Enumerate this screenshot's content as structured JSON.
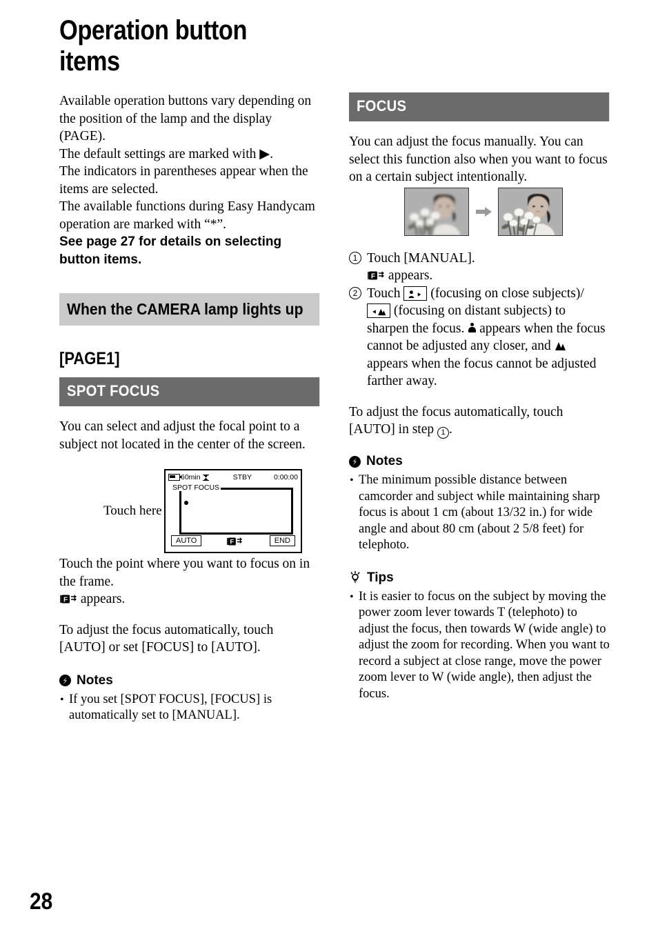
{
  "page": {
    "title": "Operation button\nitems",
    "number": "28"
  },
  "left_column": {
    "intro": "Available operation buttons vary depending on the position of the lamp and the display (PAGE).\nThe default settings are marked with ▶.\nThe indicators in parentheses appear when the items are selected.\nThe available functions during Easy Handycam operation are marked with “*”.",
    "intro_bold": "See page 27 for details on selecting button items.",
    "section_heading": "When the CAMERA lamp lights up",
    "page_label": "[PAGE1]",
    "subsection_heading": "SPOT FOCUS",
    "body1": "You can select and adjust the focal point to a subject not located in the center of the screen.",
    "diagram": {
      "callout": "Touch here",
      "battery_time": "60min",
      "status": "STBY",
      "timecode": "0:00:00",
      "mode_label": "SPOT FOCUS",
      "button_auto": "AUTO",
      "button_end": "END",
      "center_icon": "manual-focus-icon"
    },
    "body2_line1": "Touch the point where you want to focus on in the frame.",
    "body2_line2_suffix": "appears.",
    "body3": "To adjust the focus automatically, touch [AUTO] or set [FOCUS] to [AUTO].",
    "notes": {
      "title": "Notes",
      "items": [
        "If you set [SPOT FOCUS], [FOCUS] is automatically set to [MANUAL]."
      ]
    }
  },
  "right_column": {
    "subsection_heading": "FOCUS",
    "body1": "You can adjust the focus manually. You can select this function also when you want to focus on a certain subject intentionally.",
    "photos": {
      "left_caption": "out-of-focus-photo",
      "right_caption": "in-focus-photo",
      "arrow": "arrow-right-icon"
    },
    "steps": [
      {
        "num": "1",
        "text": "Touch [MANUAL].",
        "sub_suffix": "appears."
      },
      {
        "num": "2",
        "text_a": "Touch",
        "text_b": "(focusing on close subjects)/",
        "text_c": "(focusing on distant subjects) to sharpen the focus.",
        "text_d": "appears when the focus cannot be adjusted any closer, and",
        "text_e": "appears when the focus cannot be adjusted farther away."
      }
    ],
    "auto_note_a": "To adjust the focus automatically, touch [AUTO] in step",
    "auto_note_b": ".",
    "notes": {
      "title": "Notes",
      "items": [
        "The minimum possible distance between camcorder and subject while maintaining sharp focus is about 1 cm (about 13/32 in.) for wide angle and about 80 cm (about 2 5/8 feet) for telephoto."
      ]
    },
    "tips": {
      "title": "Tips",
      "items": [
        "It is easier to focus on the subject by moving the power zoom lever towards T (telephoto) to adjust the focus, then towards W (wide angle) to adjust the zoom for recording. When you want to record a subject at close range, move the power zoom lever to W (wide angle), then adjust the focus."
      ]
    }
  },
  "colors": {
    "heading_light_bg": "#c9c9c9",
    "heading_dark_bg": "#6b6b6b",
    "text": "#000000"
  }
}
